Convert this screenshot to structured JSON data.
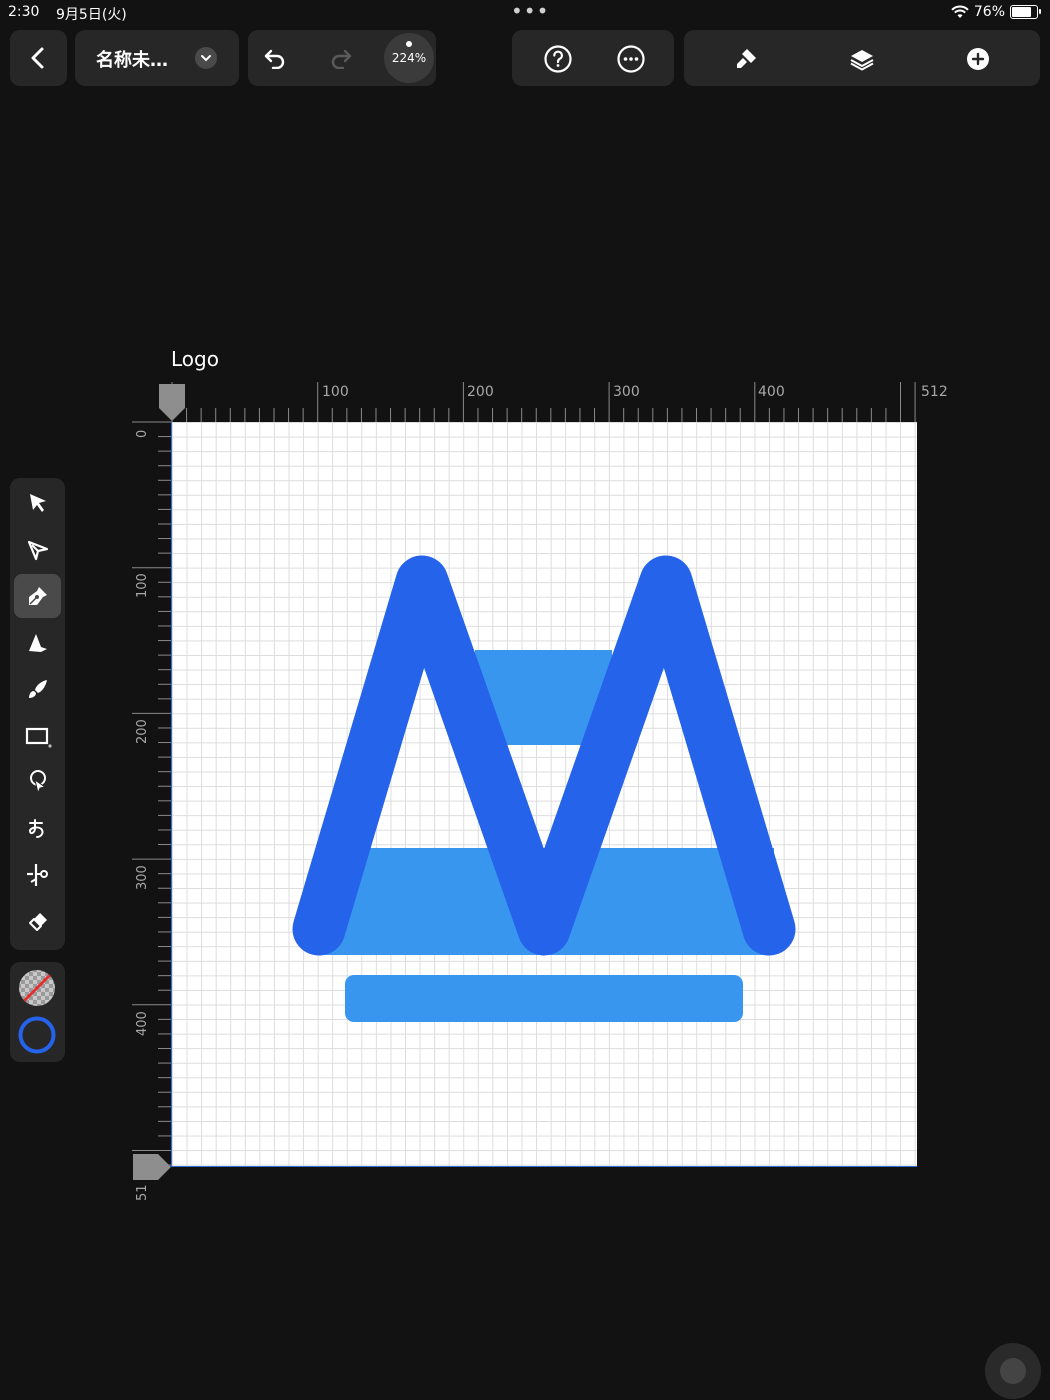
{
  "status_bar": {
    "time": "2:30",
    "date": "9月5日(火)",
    "multitask_dots": "•••",
    "battery": "76%",
    "battery_level": 0.76
  },
  "toolbar": {
    "back_icon": "chevron-left-icon",
    "document_title": "名称未…",
    "title_menu_icon": "chevron-down-icon",
    "undo_icon": "undo-icon",
    "redo_icon": "redo-icon",
    "zoom_label": "224%",
    "help_icon": "question-icon",
    "more_icon": "ellipsis-icon",
    "style_icon": "brush-icon",
    "layers_icon": "layers-icon",
    "add_icon": "plus-icon"
  },
  "canvas": {
    "artboard_name": "Logo",
    "ruler_top_labels": [
      "100",
      "200",
      "300",
      "400",
      "512"
    ],
    "ruler_left_labels": [
      "0",
      "100",
      "200",
      "300",
      "400",
      "51"
    ],
    "colors": {
      "dark_blue": "#2563EB",
      "light_blue": "#3996EE",
      "selection": "#2f6fd8"
    }
  },
  "tools": {
    "items": [
      {
        "name": "selection-tool",
        "icon": "arrow-icon"
      },
      {
        "name": "node-tool",
        "icon": "node-arrow-icon"
      },
      {
        "name": "pen-tool",
        "icon": "pen-nib-icon",
        "active": true
      },
      {
        "name": "pencil-tool",
        "icon": "pencil-icon"
      },
      {
        "name": "brush-tool",
        "icon": "brush-icon"
      },
      {
        "name": "rectangle-tool",
        "icon": "rectangle-icon"
      },
      {
        "name": "fill-tool",
        "icon": "fill-icon"
      },
      {
        "name": "text-tool",
        "icon": "text-icon"
      },
      {
        "name": "scissors-tool",
        "icon": "scissors-icon"
      },
      {
        "name": "eraser-tool",
        "icon": "eraser-icon"
      }
    ],
    "fill_color_state": "none",
    "stroke_color": "#2563EB"
  }
}
